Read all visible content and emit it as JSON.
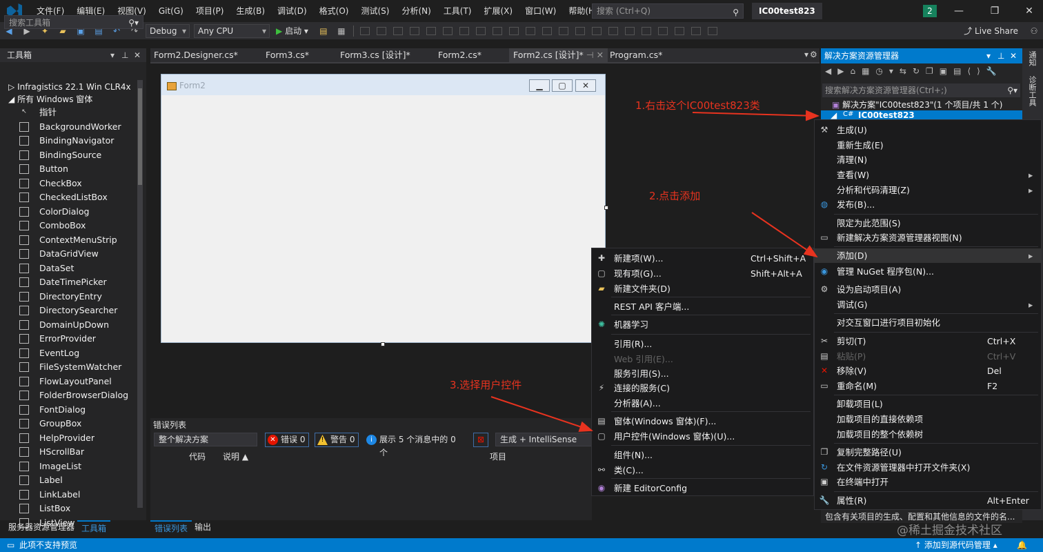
{
  "menu": [
    "文件(F)",
    "编辑(E)",
    "视图(V)",
    "Git(G)",
    "项目(P)",
    "生成(B)",
    "调试(D)",
    "格式(O)",
    "测试(S)",
    "分析(N)",
    "工具(T)",
    "扩展(X)",
    "窗口(W)",
    "帮助(H)"
  ],
  "search_placeholder": "搜索 (Ctrl+Q)",
  "solution_name": "IC00test823",
  "notification_count": "2",
  "live_share": "Live Share",
  "toolbar": {
    "config": "Debug",
    "platform": "Any CPU",
    "start": "启动"
  },
  "toolbox": {
    "title": "工具箱",
    "search": "搜索工具箱",
    "group1": "Infragistics 22.1 Win CLR4x",
    "group2": "所有 Windows 窗体",
    "items": [
      "指针",
      "BackgroundWorker",
      "BindingNavigator",
      "BindingSource",
      "Button",
      "CheckBox",
      "CheckedListBox",
      "ColorDialog",
      "ComboBox",
      "ContextMenuStrip",
      "DataGridView",
      "DataSet",
      "DateTimePicker",
      "DirectoryEntry",
      "DirectorySearcher",
      "DomainUpDown",
      "ErrorProvider",
      "EventLog",
      "FileSystemWatcher",
      "FlowLayoutPanel",
      "FolderBrowserDialog",
      "FontDialog",
      "GroupBox",
      "HelpProvider",
      "HScrollBar",
      "ImageList",
      "Label",
      "LinkLabel",
      "ListBox",
      "ListView"
    ]
  },
  "bottom_tabs": {
    "server_explorer": "服务器资源管理器",
    "toolbox": "工具箱",
    "errorlist": "错误列表",
    "output": "输出"
  },
  "doc_tabs": [
    "Form2.Designer.cs*",
    "Form3.cs*",
    "Form3.cs [设计]*",
    "Form2.cs*",
    "Form2.cs [设计]*",
    "Program.cs*"
  ],
  "form_caption": "Form2",
  "annotations": [
    "1.右击这个IC00test823类",
    "2.点击添加",
    "3.选择用户控件"
  ],
  "errorlist": {
    "title": "错误列表",
    "scope": "整个解决方案",
    "errors": "错误 0",
    "warnings": "警告 0",
    "messages": "展示 5 个消息中的 0 个",
    "build": "生成 + IntelliSense",
    "col_code": "代码",
    "col_desc": "说明",
    "col_project": "项目"
  },
  "solex": {
    "title": "解决方案资源管理器",
    "search": "搜索解决方案资源管理器(Ctrl+;)",
    "solution": "解决方案\"IC00test823\"(1 个项目/共 1 个)",
    "project": "IC00test823",
    "desc": "包含有关项目的生成、配置和其他信息的文件的名..."
  },
  "side_tabs": [
    "通知",
    "诊断工具"
  ],
  "context_menu": [
    {
      "label": "生成(U)",
      "icon": "build-icon"
    },
    {
      "label": "重新生成(E)"
    },
    {
      "label": "清理(N)"
    },
    {
      "label": "查看(W)",
      "arrow": true
    },
    {
      "label": "分析和代码清理(Z)",
      "arrow": true
    },
    {
      "label": "发布(B)...",
      "icon": "globe-icon"
    },
    {
      "label": "限定为此范围(S)"
    },
    {
      "label": "新建解决方案资源管理器视图(N)",
      "icon": "window-icon"
    },
    {
      "label": "添加(D)",
      "arrow": true,
      "highlight": true
    },
    {
      "label": "管理 NuGet 程序包(N)...",
      "icon": "nuget-icon"
    },
    {
      "label": "设为启动项目(A)",
      "icon": "gear-icon"
    },
    {
      "label": "调试(G)",
      "arrow": true
    },
    {
      "label": "对交互窗口进行项目初始化"
    },
    {
      "label": "剪切(T)",
      "shortcut": "Ctrl+X",
      "icon": "scissors-icon"
    },
    {
      "label": "粘贴(P)",
      "shortcut": "Ctrl+V",
      "disabled": true,
      "icon": "paste-icon"
    },
    {
      "label": "移除(V)",
      "shortcut": "Del",
      "icon": "remove-icon"
    },
    {
      "label": "重命名(M)",
      "shortcut": "F2",
      "icon": "rename-icon"
    },
    {
      "label": "卸载项目(L)"
    },
    {
      "label": "加载项目的直接依赖项"
    },
    {
      "label": "加载项目的整个依赖树"
    },
    {
      "label": "复制完整路径(U)",
      "icon": "copy-icon"
    },
    {
      "label": "在文件资源管理器中打开文件夹(X)",
      "icon": "open-folder-icon"
    },
    {
      "label": "在终端中打开",
      "icon": "terminal-icon"
    },
    {
      "label": "属性(R)",
      "shortcut": "Alt+Enter",
      "icon": "wrench-icon"
    }
  ],
  "add_menu": [
    {
      "label": "新建项(W)...",
      "shortcut": "Ctrl+Shift+A",
      "icon": "new-item-icon"
    },
    {
      "label": "现有项(G)...",
      "shortcut": "Shift+Alt+A",
      "icon": "existing-item-icon"
    },
    {
      "label": "新建文件夹(D)",
      "icon": "folder-icon"
    },
    {
      "label": "REST API 客户端..."
    },
    {
      "label": "机器学习",
      "icon": "ml-icon"
    },
    {
      "label": "引用(R)..."
    },
    {
      "label": "Web 引用(E)...",
      "disabled": true
    },
    {
      "label": "服务引用(S)..."
    },
    {
      "label": "连接的服务(C)",
      "icon": "connected-service-icon"
    },
    {
      "label": "分析器(A)..."
    },
    {
      "label": "窗体(Windows 窗体)(F)...",
      "icon": "form-icon"
    },
    {
      "label": "用户控件(Windows 窗体)(U)...",
      "icon": "usercontrol-icon"
    },
    {
      "label": "组件(N)..."
    },
    {
      "label": "类(C)...",
      "icon": "class-icon"
    },
    {
      "label": "新建 EditorConfig",
      "icon": "bulb-icon"
    }
  ],
  "status": {
    "left": "此项不支持预览",
    "right": "添加到源代码管理"
  },
  "watermark": "@稀土掘金技术社区"
}
